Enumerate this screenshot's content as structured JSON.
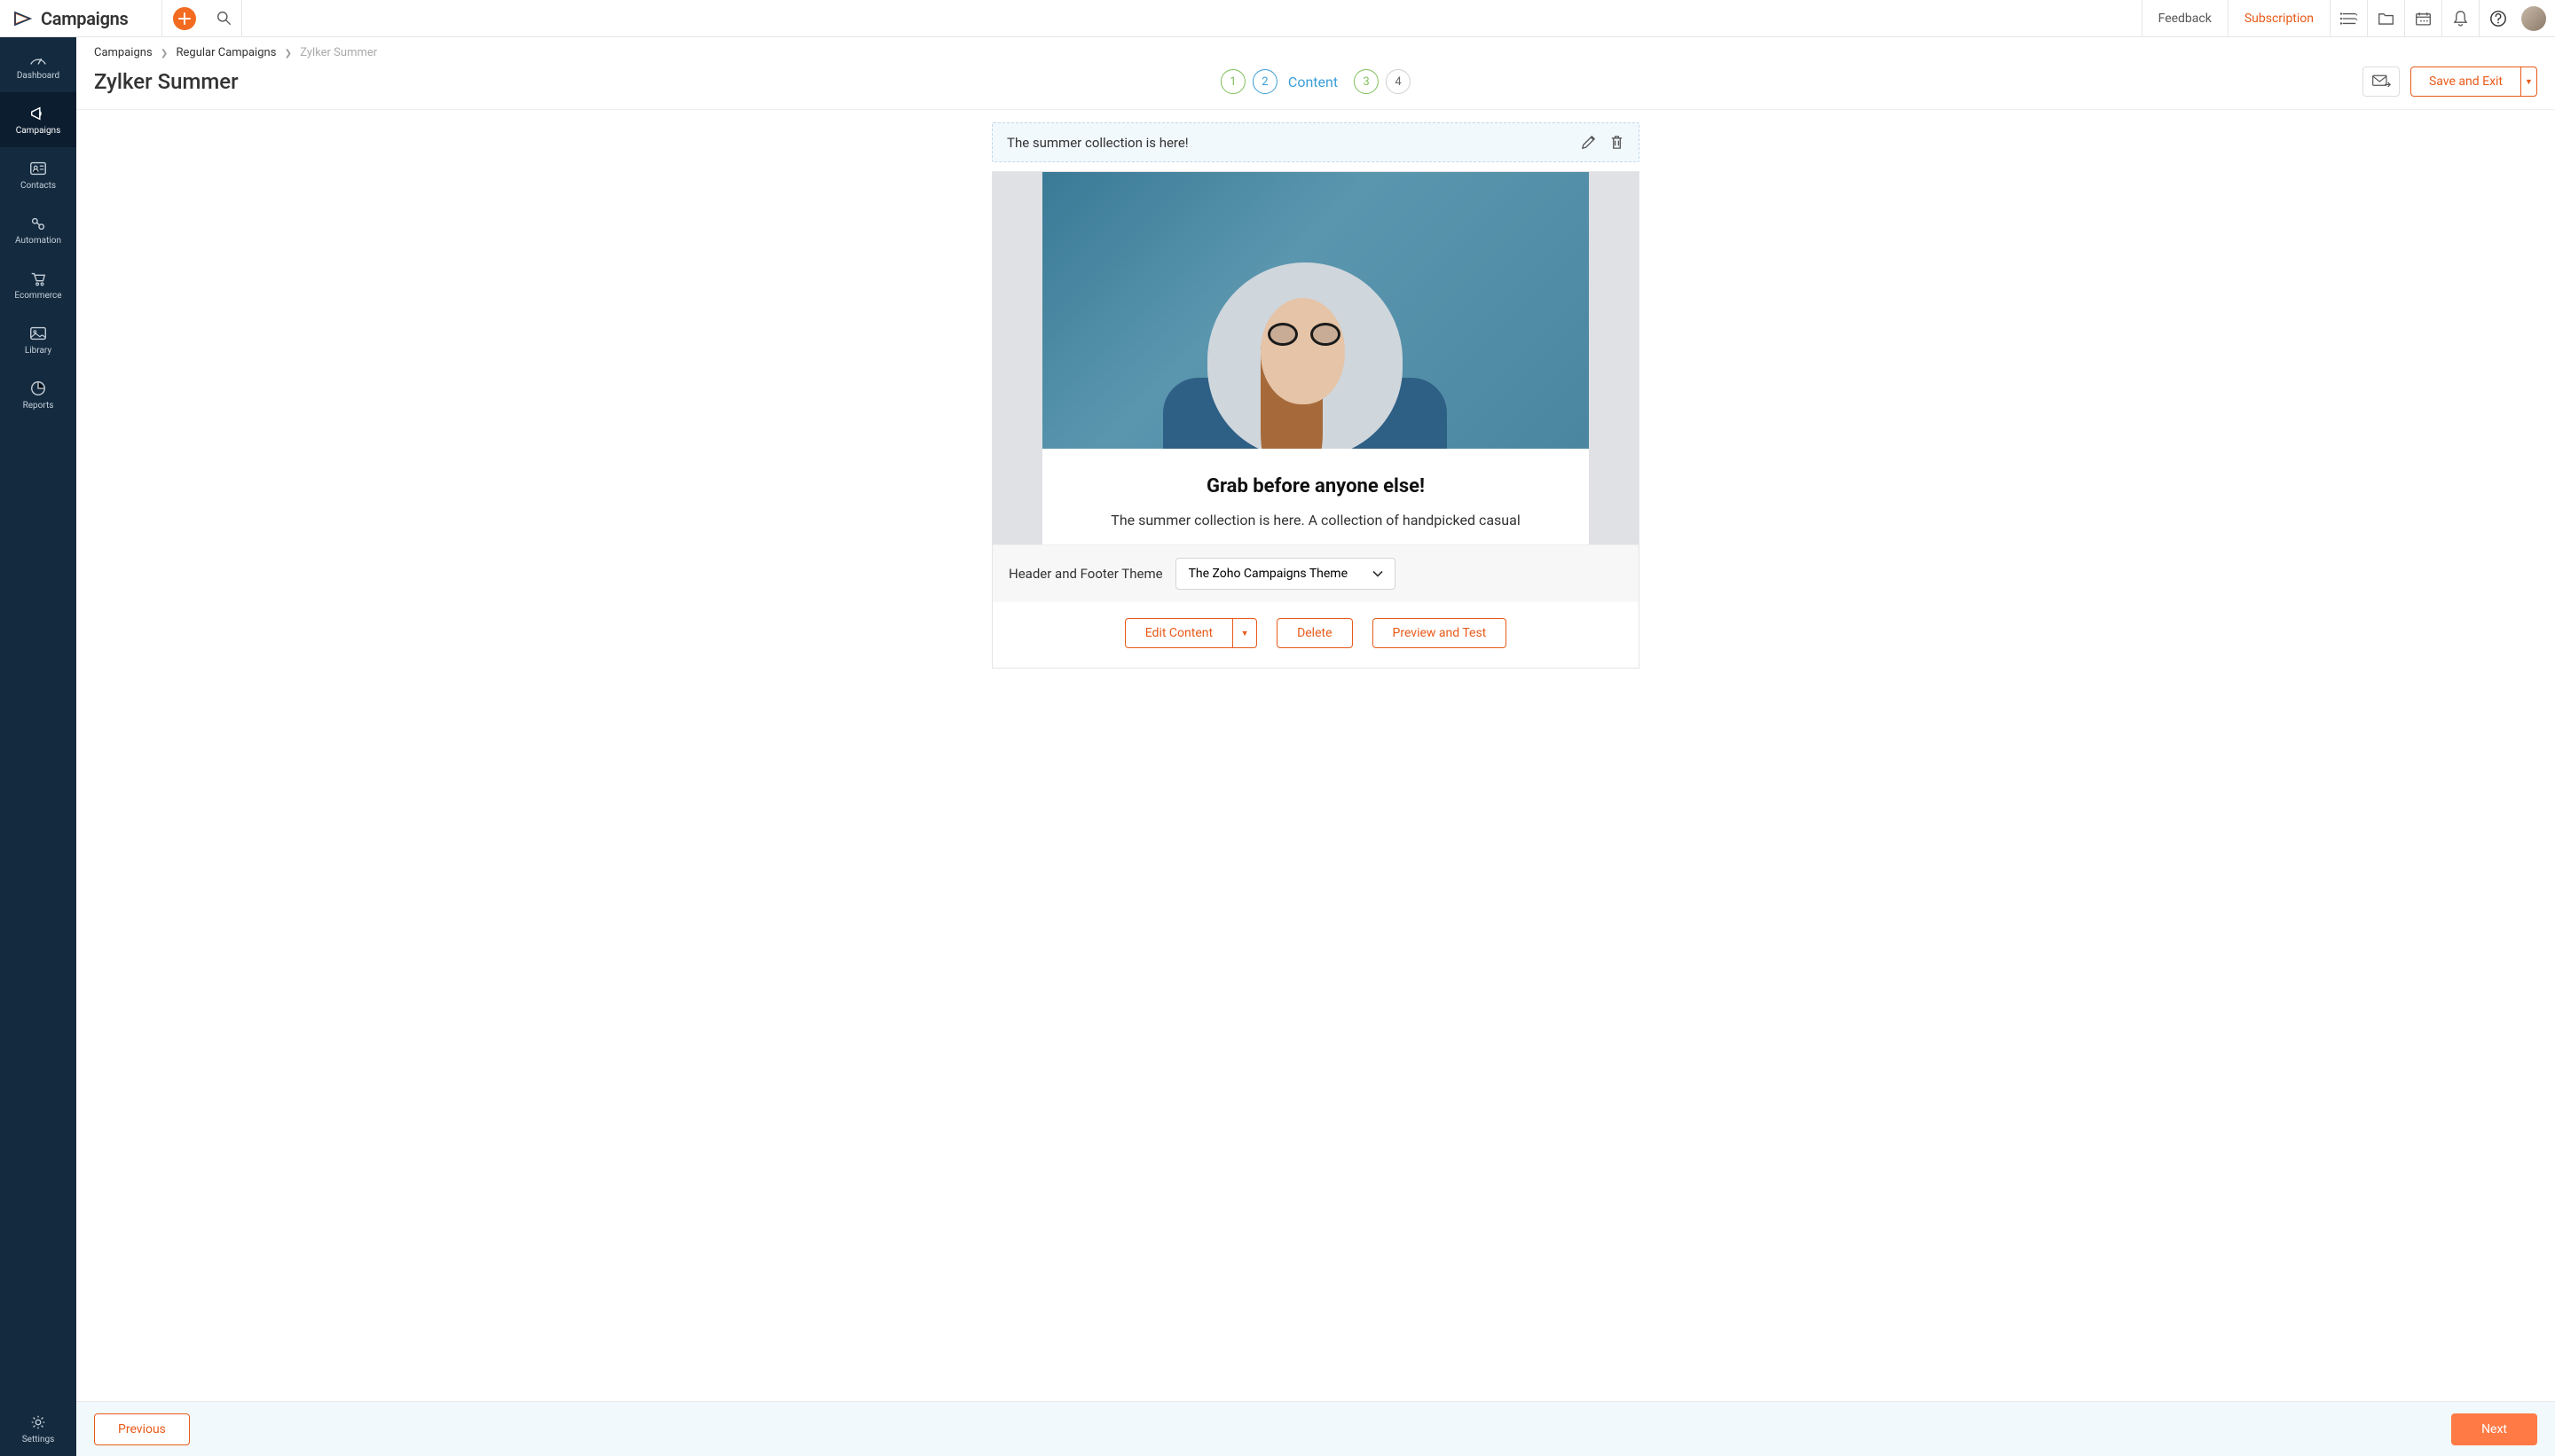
{
  "app": {
    "name": "Campaigns"
  },
  "topbar": {
    "feedback": "Feedback",
    "subscription": "Subscription"
  },
  "sidebar": {
    "items": [
      {
        "label": "Dashboard"
      },
      {
        "label": "Campaigns"
      },
      {
        "label": "Contacts"
      },
      {
        "label": "Automation"
      },
      {
        "label": "Ecommerce"
      },
      {
        "label": "Library"
      },
      {
        "label": "Reports"
      }
    ],
    "settings": "Settings"
  },
  "breadcrumb": {
    "root": "Campaigns",
    "section": "Regular Campaigns",
    "current": "Zylker Summer"
  },
  "page": {
    "title": "Zylker Summer",
    "save_exit": "Save and Exit"
  },
  "steps": {
    "s1": "1",
    "s2": "2",
    "label2": "Content",
    "s3": "3",
    "s4": "4"
  },
  "subject": {
    "text": "The summer collection is here!"
  },
  "preview": {
    "headline": "Grab before anyone else!",
    "body": "The summer collection is here. A collection of handpicked casual"
  },
  "theme": {
    "label": "Header and Footer Theme",
    "selected": "The Zoho Campaigns Theme"
  },
  "actions": {
    "edit": "Edit Content",
    "delete": "Delete",
    "preview": "Preview and Test"
  },
  "footer": {
    "prev": "Previous",
    "next": "Next"
  }
}
